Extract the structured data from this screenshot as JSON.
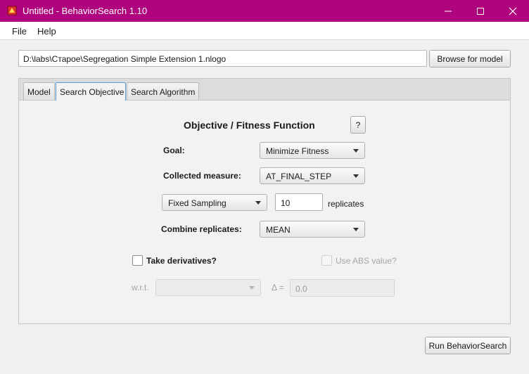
{
  "window": {
    "title": "Untitled - BehaviorSearch 1.10",
    "title_bar_color": "#b0047f",
    "controls": [
      "minimize-icon",
      "maximize-icon",
      "close-icon"
    ]
  },
  "menu": {
    "file": "File",
    "help": "Help"
  },
  "model": {
    "path": "D:\\labs\\Старое\\Segregation Simple Extension 1.nlogo",
    "browse_label": "Browse for model"
  },
  "tabs": [
    {
      "label": "Model",
      "active": false
    },
    {
      "label": "Search Objective",
      "active": true
    },
    {
      "label": "Search Algorithm",
      "active": false
    }
  ],
  "objective": {
    "heading": "Objective / Fitness Function",
    "help_label": "?",
    "goal_label": "Goal:",
    "goal_value": "Minimize Fitness",
    "measure_label": "Collected measure:",
    "measure_value": "AT_FINAL_STEP",
    "sampling_value": "Fixed Sampling",
    "replicates_value": "10",
    "replicates_label": "replicates",
    "combine_label": "Combine replicates:",
    "combine_value": "MEAN",
    "derivatives_label": "Take derivatives?",
    "abs_label": "Use ABS value?",
    "wrt_label": "w.r.t.",
    "wrt_value": "",
    "delta_label": "Δ =",
    "delta_value": "0.0"
  },
  "footer": {
    "run_label": "Run BehaviorSearch"
  }
}
